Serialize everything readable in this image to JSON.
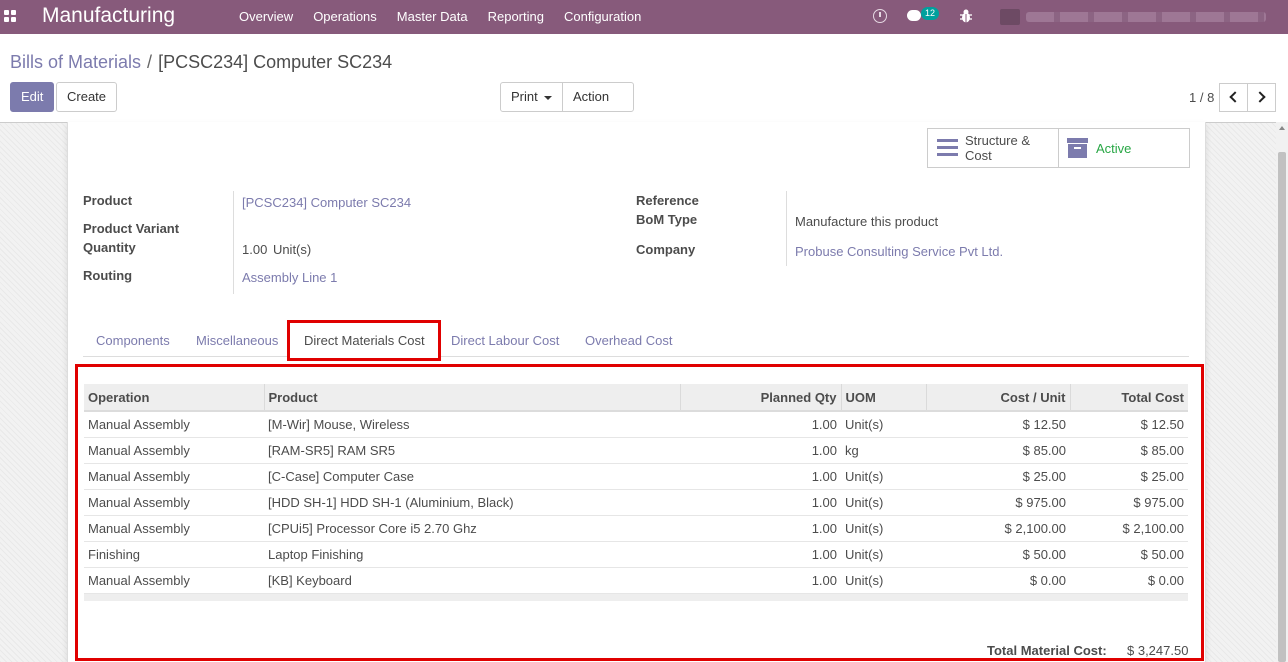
{
  "navbar": {
    "app_name": "Manufacturing",
    "menu": [
      "Overview",
      "Operations",
      "Master Data",
      "Reporting",
      "Configuration"
    ],
    "chat_badge": "12",
    "icons": [
      "apps-icon",
      "clock-icon",
      "chat-icon",
      "bug-icon"
    ]
  },
  "breadcrumb": {
    "parent": "Bills of Materials",
    "separator": "/",
    "current": "[PCSC234] Computer SC234"
  },
  "buttons": {
    "edit": "Edit",
    "create": "Create",
    "print": "Print",
    "action": "Action"
  },
  "pager": {
    "value": "1 / 8"
  },
  "smart_buttons": {
    "structure_line1": "Structure &",
    "structure_line2": "Cost",
    "active": "Active"
  },
  "fields": {
    "product_label": "Product",
    "product_value": "[PCSC234] Computer SC234",
    "variant_label": "Product Variant",
    "quantity_label": "Quantity",
    "quantity_value": "1.00",
    "quantity_unit": "Unit(s)",
    "routing_label": "Routing",
    "routing_value": "Assembly Line 1",
    "reference_label": "Reference",
    "bom_type_label": "BoM Type",
    "bom_type_value": "Manufacture this product",
    "company_label": "Company",
    "company_value": "Probuse Consulting Service Pvt Ltd."
  },
  "tabs": [
    "Components",
    "Miscellaneous",
    "Direct Materials Cost",
    "Direct Labour Cost",
    "Overhead Cost"
  ],
  "active_tab": "Direct Materials Cost",
  "table": {
    "columns": [
      "Operation",
      "Product",
      "Planned Qty",
      "UOM",
      "Cost / Unit",
      "Total Cost"
    ],
    "rows": [
      [
        "Manual Assembly",
        "[M-Wir] Mouse, Wireless",
        "1.00",
        "Unit(s)",
        "$ 12.50",
        "$ 12.50"
      ],
      [
        "Manual Assembly",
        "[RAM-SR5] RAM SR5",
        "1.00",
        "kg",
        "$ 85.00",
        "$ 85.00"
      ],
      [
        "Manual Assembly",
        "[C-Case] Computer Case",
        "1.00",
        "Unit(s)",
        "$ 25.00",
        "$ 25.00"
      ],
      [
        "Manual Assembly",
        "[HDD SH-1] HDD SH-1 (Aluminium, Black)",
        "1.00",
        "Unit(s)",
        "$ 975.00",
        "$ 975.00"
      ],
      [
        "Manual Assembly",
        "[CPUi5] Processor Core i5 2.70 Ghz",
        "1.00",
        "Unit(s)",
        "$ 2,100.00",
        "$ 2,100.00"
      ],
      [
        "Finishing",
        "Laptop Finishing",
        "1.00",
        "Unit(s)",
        "$ 50.00",
        "$ 50.00"
      ],
      [
        "Manual Assembly",
        "[KB] Keyboard",
        "1.00",
        "Unit(s)",
        "$ 0.00",
        "$ 0.00"
      ]
    ]
  },
  "total": {
    "label": "Total Material Cost:",
    "value": "$ 3,247.50"
  },
  "colors": {
    "navbar": "#875a7b",
    "primary": "#7c7bad",
    "highlight": "#e00000",
    "active_green": "#28a745"
  }
}
